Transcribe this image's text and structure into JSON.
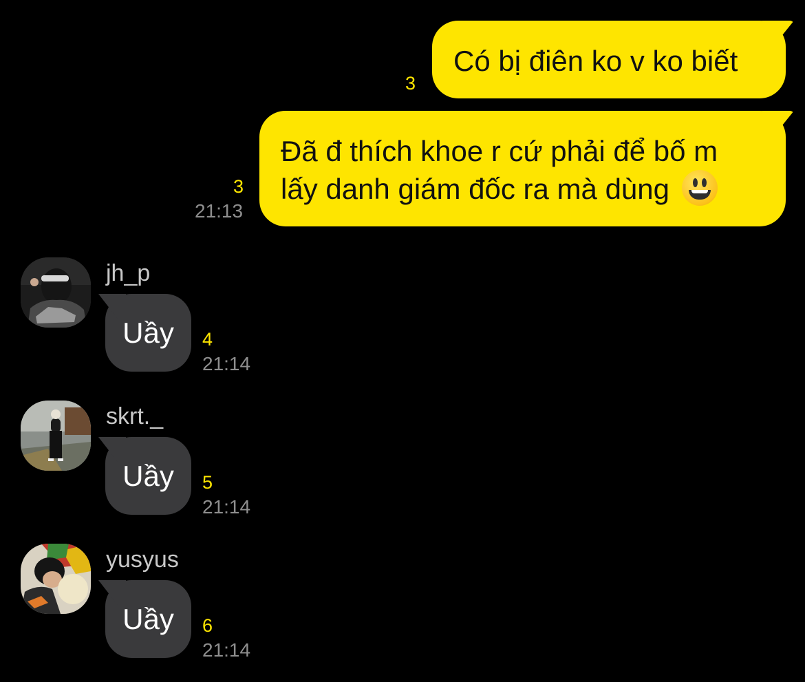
{
  "colors": {
    "background": "#000000",
    "outgoing_bubble": "#FEE500",
    "incoming_bubble": "#3a3a3c",
    "unread_count": "#FEE500",
    "timestamp": "#8e8e8e"
  },
  "outgoing": [
    {
      "text": "Có bị điên ko v ko biết",
      "unread": "3",
      "time": ""
    },
    {
      "text_line1": "Đã đ thích khoe r cứ phải để bố m",
      "text_line2": "lấy danh giám đốc ra mà dùng",
      "emoji": "smiley-emoji",
      "unread": "3",
      "time": "21:13"
    }
  ],
  "incoming": [
    {
      "sender": "jh_p",
      "avatar": "avatar-jh_p",
      "text": "Uầy",
      "unread": "4",
      "time": "21:14"
    },
    {
      "sender": "skrt._",
      "avatar": "avatar-skrt",
      "text": "Uầy",
      "unread": "5",
      "time": "21:14"
    },
    {
      "sender": "yusyus",
      "avatar": "avatar-yusyus",
      "text": "Uầy",
      "unread": "6",
      "time": "21:14"
    }
  ]
}
